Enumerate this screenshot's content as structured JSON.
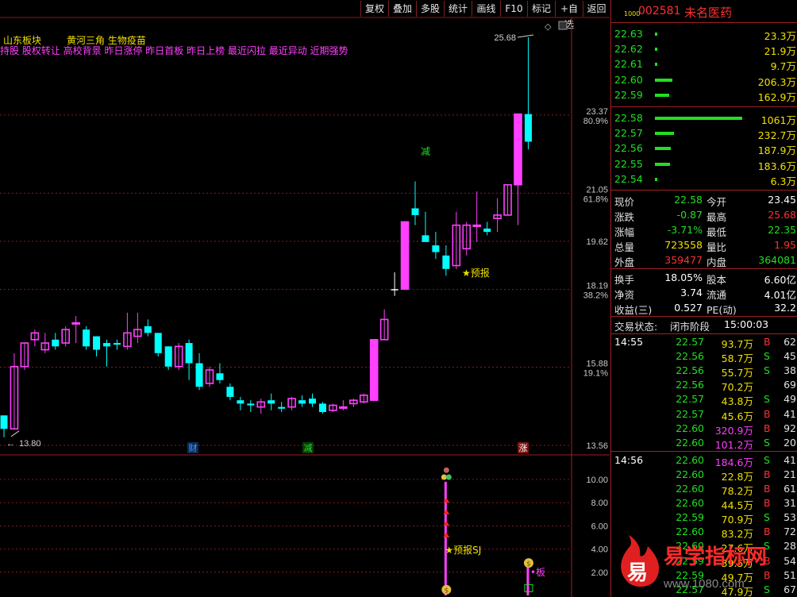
{
  "toolbar": {
    "buttons": [
      "复权",
      "叠加",
      "多股",
      "统计",
      "画线",
      "F10",
      "标记",
      "+自选",
      "返回"
    ]
  },
  "chart": {
    "header_sector": "山东板块",
    "header_concepts": "黄河三角 生物疫苗",
    "header_tags": "持股 股权转让 高校背景 昨日涨停 昨日首板 昨日上榜 最近闪拉 最近异动 近期强势",
    "high_label": "25.68",
    "low_label": "13.80",
    "event_markers": [
      "财",
      "减",
      "涨"
    ],
    "overlay_texts": [
      "减",
      "★预报",
      "★预报SJ",
      "板"
    ]
  },
  "chart_data": [
    {
      "type": "candlestick",
      "title": "",
      "y_ticks": [
        {
          "value": "23.37",
          "pct": "80.9%"
        },
        {
          "value": "21.05",
          "pct": "61.8%"
        },
        {
          "value": "19.62",
          "pct": ""
        },
        {
          "value": "18.19",
          "pct": "38.2%"
        },
        {
          "value": "15.88",
          "pct": "19.1%"
        },
        {
          "value": "13.56",
          "pct": ""
        }
      ],
      "ylim": [
        13.56,
        25.68
      ],
      "candles": [
        {
          "o": 14.45,
          "c": 14.05,
          "h": 14.45,
          "l": 13.8
        },
        {
          "o": 14.05,
          "c": 15.9,
          "h": 16.3,
          "l": 14.05
        },
        {
          "o": 15.9,
          "c": 16.6,
          "h": 16.6,
          "l": 15.8
        },
        {
          "o": 16.7,
          "c": 16.9,
          "h": 17.0,
          "l": 16.5
        },
        {
          "o": 16.4,
          "c": 16.6,
          "h": 16.9,
          "l": 16.3
        },
        {
          "o": 16.7,
          "c": 16.5,
          "h": 16.9,
          "l": 16.4
        },
        {
          "o": 16.6,
          "c": 17.0,
          "h": 17.1,
          "l": 16.5
        },
        {
          "o": 17.2,
          "c": 17.2,
          "h": 17.4,
          "l": 16.6
        },
        {
          "o": 17.0,
          "c": 16.5,
          "h": 17.1,
          "l": 16.4
        },
        {
          "o": 16.8,
          "c": 16.4,
          "h": 16.8,
          "l": 16.2
        },
        {
          "o": 16.6,
          "c": 16.5,
          "h": 16.7,
          "l": 15.9
        },
        {
          "o": 16.6,
          "c": 16.55,
          "h": 16.7,
          "l": 16.4
        },
        {
          "o": 16.5,
          "c": 16.9,
          "h": 17.5,
          "l": 16.4
        },
        {
          "o": 16.8,
          "c": 17.0,
          "h": 17.5,
          "l": 16.6
        },
        {
          "o": 17.1,
          "c": 16.9,
          "h": 17.3,
          "l": 16.8
        },
        {
          "o": 16.9,
          "c": 16.3,
          "h": 16.9,
          "l": 16.2
        },
        {
          "o": 16.5,
          "c": 15.9,
          "h": 16.5,
          "l": 15.8
        },
        {
          "o": 15.9,
          "c": 16.5,
          "h": 16.6,
          "l": 15.8
        },
        {
          "o": 16.6,
          "c": 16.0,
          "h": 16.7,
          "l": 15.5
        },
        {
          "o": 16.0,
          "c": 15.3,
          "h": 16.3,
          "l": 15.2
        },
        {
          "o": 15.4,
          "c": 15.8,
          "h": 15.9,
          "l": 15.3
        },
        {
          "o": 15.7,
          "c": 15.5,
          "h": 16.0,
          "l": 15.4
        },
        {
          "o": 15.3,
          "c": 15.0,
          "h": 15.4,
          "l": 14.9
        },
        {
          "o": 14.9,
          "c": 14.8,
          "h": 15.0,
          "l": 14.6
        },
        {
          "o": 14.8,
          "c": 14.75,
          "h": 14.9,
          "l": 14.55
        },
        {
          "o": 14.7,
          "c": 14.85,
          "h": 14.95,
          "l": 14.5
        },
        {
          "o": 14.9,
          "c": 14.8,
          "h": 15.1,
          "l": 14.6
        },
        {
          "o": 14.7,
          "c": 14.65,
          "h": 14.85,
          "l": 14.55
        },
        {
          "o": 14.7,
          "c": 14.95,
          "h": 15.0,
          "l": 14.6
        },
        {
          "o": 14.9,
          "c": 14.8,
          "h": 15.05,
          "l": 14.7
        },
        {
          "o": 14.95,
          "c": 14.8,
          "h": 15.1,
          "l": 14.7
        },
        {
          "o": 14.8,
          "c": 14.55,
          "h": 14.85,
          "l": 14.5
        },
        {
          "o": 14.6,
          "c": 14.75,
          "h": 14.8,
          "l": 14.55
        },
        {
          "o": 14.7,
          "c": 14.7,
          "h": 14.9,
          "l": 14.6
        },
        {
          "o": 14.8,
          "c": 14.9,
          "h": 14.95,
          "l": 14.7
        },
        {
          "o": 14.85,
          "c": 15.05,
          "h": 15.1,
          "l": 14.8
        },
        {
          "o": 14.9,
          "c": 16.7,
          "h": 16.7,
          "l": 14.9
        },
        {
          "o": 16.7,
          "c": 17.3,
          "h": 17.6,
          "l": 16.7
        },
        {
          "o": 18.2,
          "c": 18.2,
          "h": 18.7,
          "l": 18.0
        },
        {
          "o": 18.2,
          "c": 20.2,
          "h": 20.2,
          "l": 18.2
        },
        {
          "o": 20.6,
          "c": 20.4,
          "h": 21.4,
          "l": 20.1
        },
        {
          "o": 19.8,
          "c": 19.6,
          "h": 20.5,
          "l": 19.6
        },
        {
          "o": 19.5,
          "c": 19.3,
          "h": 19.9,
          "l": 19.1
        },
        {
          "o": 19.2,
          "c": 18.8,
          "h": 19.5,
          "l": 18.6
        },
        {
          "o": 18.9,
          "c": 20.1,
          "h": 20.5,
          "l": 18.8
        },
        {
          "o": 19.4,
          "c": 20.1,
          "h": 20.2,
          "l": 19.2
        },
        {
          "o": 20.1,
          "c": 20.1,
          "h": 21.1,
          "l": 19.6
        },
        {
          "o": 20.0,
          "c": 19.9,
          "h": 20.2,
          "l": 19.8
        },
        {
          "o": 20.3,
          "c": 20.4,
          "h": 20.9,
          "l": 19.9
        },
        {
          "o": 20.4,
          "c": 21.3,
          "h": 21.3,
          "l": 20.4
        },
        {
          "o": 21.3,
          "c": 23.4,
          "h": 23.4,
          "l": 20.1
        },
        {
          "o": 23.4,
          "c": 22.58,
          "h": 25.68,
          "l": 22.35
        }
      ]
    },
    {
      "type": "indicator",
      "title": "",
      "y_ticks": [
        "10.00",
        "8.00",
        "6.00",
        "4.00",
        "2.00"
      ],
      "ylim": [
        0,
        11.5
      ],
      "bars": [
        {
          "index": 43,
          "value": 9.8,
          "color": "#ff40ff"
        },
        {
          "index": 51,
          "value": 2.7,
          "color": "#ff40ff"
        }
      ]
    }
  ],
  "quote": {
    "code": "002581",
    "name": "未名医药",
    "level_tag": "1000",
    "asks": [
      {
        "price": "22.63",
        "vol": "23.3万",
        "bar": 0.02
      },
      {
        "price": "22.62",
        "vol": "21.9万",
        "bar": 0.02
      },
      {
        "price": "22.61",
        "vol": "9.7万",
        "bar": 0.01
      },
      {
        "price": "22.60",
        "vol": "206.3万",
        "bar": 0.2
      },
      {
        "price": "22.59",
        "vol": "162.9万",
        "bar": 0.16
      }
    ],
    "bids": [
      {
        "price": "22.58",
        "vol": "1061万",
        "bar": 1.0
      },
      {
        "price": "22.57",
        "vol": "232.7万",
        "bar": 0.22
      },
      {
        "price": "22.56",
        "vol": "187.9万",
        "bar": 0.18
      },
      {
        "price": "22.55",
        "vol": "183.6万",
        "bar": 0.17
      },
      {
        "price": "22.54",
        "vol": "6.3万",
        "bar": 0.01
      }
    ],
    "stats": [
      {
        "l1": "现价",
        "v1": "22.58",
        "c1": "g",
        "l2": "今开",
        "v2": "23.45",
        "c2": "w"
      },
      {
        "l1": "涨跌",
        "v1": "-0.87",
        "c1": "g",
        "l2": "最高",
        "v2": "25.68",
        "c2": "r"
      },
      {
        "l1": "涨幅",
        "v1": "-3.71%",
        "c1": "g",
        "l2": "最低",
        "v2": "22.35",
        "c2": "g"
      },
      {
        "l1": "总量",
        "v1": "723558",
        "c1": "y",
        "l2": "量比",
        "v2": "1.95",
        "c2": "r"
      },
      {
        "l1": "外盘",
        "v1": "359477",
        "c1": "r",
        "l2": "内盘",
        "v2": "364081",
        "c2": "g"
      }
    ],
    "fundamentals": [
      {
        "l1": "换手",
        "v1": "18.05%",
        "l2": "股本",
        "v2": "6.60亿"
      },
      {
        "l1": "净资",
        "v1": "3.74",
        "l2": "流通",
        "v2": "4.01亿"
      },
      {
        "l1": "收益(三)",
        "v1": "0.527",
        "l2": "PE(动)",
        "v2": "32.2"
      }
    ],
    "trade_status_label": "交易状态:",
    "trade_status": "闭市阶段",
    "trade_time": "15:00:03",
    "ticks": [
      {
        "time": "14:55",
        "price": "22.57",
        "vol": "93.7万",
        "side": "B",
        "n": "62"
      },
      {
        "time": "",
        "price": "22.56",
        "vol": "58.7万",
        "side": "S",
        "n": "45"
      },
      {
        "time": "",
        "price": "22.56",
        "vol": "55.7万",
        "side": "S",
        "n": "38"
      },
      {
        "time": "",
        "price": "22.56",
        "vol": "70.2万",
        "side": "",
        "n": "69"
      },
      {
        "time": "",
        "price": "22.57",
        "vol": "43.8万",
        "side": "S",
        "n": "49"
      },
      {
        "time": "",
        "price": "22.57",
        "vol": "45.6万",
        "side": "B",
        "n": "41"
      },
      {
        "time": "",
        "price": "22.60",
        "vol": "320.9万",
        "side": "B",
        "n": "92"
      },
      {
        "time": "",
        "price": "22.60",
        "vol": "101.2万",
        "side": "S",
        "n": "20"
      },
      {
        "time": "14:56",
        "price": "22.60",
        "vol": "184.6万",
        "side": "S",
        "n": "41"
      },
      {
        "time": "",
        "price": "22.60",
        "vol": "22.8万",
        "side": "B",
        "n": "21"
      },
      {
        "time": "",
        "price": "22.60",
        "vol": "78.2万",
        "side": "B",
        "n": "61"
      },
      {
        "time": "",
        "price": "22.60",
        "vol": "44.5万",
        "side": "B",
        "n": "31"
      },
      {
        "time": "",
        "price": "22.59",
        "vol": "70.9万",
        "side": "S",
        "n": "53"
      },
      {
        "time": "",
        "price": "22.60",
        "vol": "83.2万",
        "side": "B",
        "n": "72"
      },
      {
        "time": "",
        "price": "22.60",
        "vol": "27.6万",
        "side": "S",
        "n": "28"
      },
      {
        "time": "",
        "price": "22.59",
        "vol": "39.5万",
        "side": "B",
        "n": "54"
      },
      {
        "time": "",
        "price": "22.59",
        "vol": "49.7万",
        "side": "B",
        "n": "51"
      },
      {
        "time": "",
        "price": "22.57",
        "vol": "47.9万",
        "side": "S",
        "n": "67"
      }
    ]
  },
  "watermark": {
    "icon_char": "易",
    "brand": "易学指标网",
    "url": "www.1080.com"
  },
  "colors": {
    "up": "#ff40ff",
    "down": "#00ffff",
    "bg": "#000000",
    "grid": "#8a1a1a",
    "green": "#20e020",
    "red": "#ff3030",
    "yellow": "#f0e000"
  }
}
